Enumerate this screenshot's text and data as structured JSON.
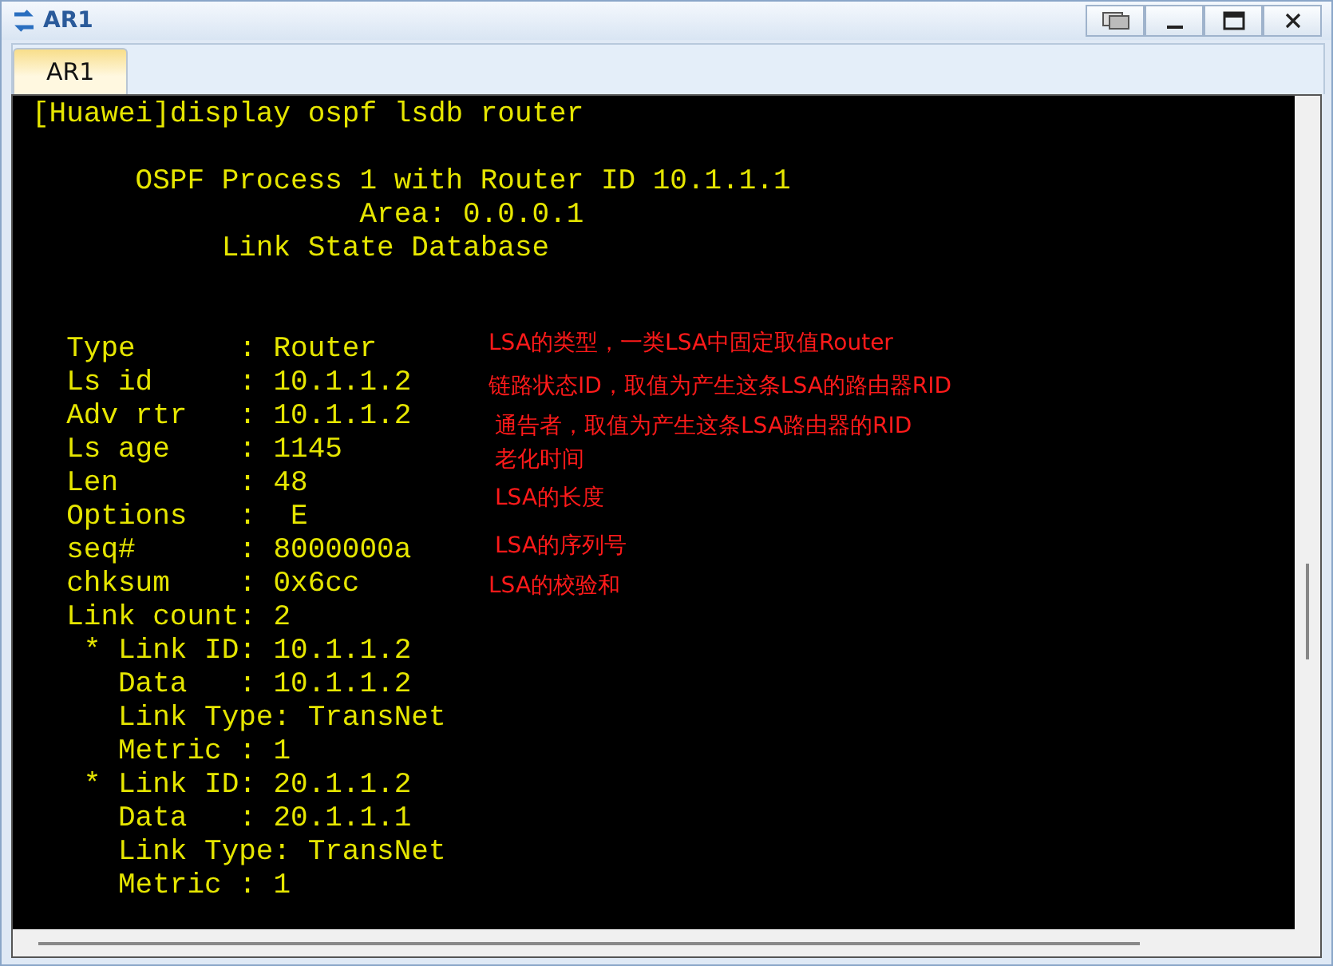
{
  "window": {
    "title": "AR1"
  },
  "tabs": [
    {
      "label": "AR1",
      "selected": true
    }
  ],
  "terminal": {
    "blocks": [
      {
        "lines": [
          "[Huawei]display ospf lsdb router"
        ]
      },
      {
        "lines": [
          "      OSPF Process 1 with Router ID 10.1.1.1",
          "                   Area: 0.0.0.1",
          "           Link State Database"
        ]
      },
      {
        "lines": [
          "  Type      : Router",
          "  Ls id     : 10.1.1.2",
          "  Adv rtr   : 10.1.1.2",
          "  Ls age    : 1145",
          "  Len       : 48",
          "  Options   :  E",
          "  seq#      : 8000000a",
          "  chksum    : 0x6cc",
          "  Link count: 2",
          "   * Link ID: 10.1.1.2",
          "     Data   : 10.1.1.2",
          "     Link Type: TransNet",
          "     Metric : 1",
          "   * Link ID: 20.1.1.2",
          "     Data   : 20.1.1.1",
          "     Link Type: TransNet",
          "     Metric : 1"
        ]
      }
    ]
  },
  "annotations": [
    "LSA的类型，一类LSA中固定取值Router",
    "链路状态ID，取值为产生这条LSA的路由器RID",
    "通告者，取值为产生这条LSA路由器的RID",
    "老化时间",
    "LSA的长度",
    "LSA的序列号",
    "LSA的校验和"
  ]
}
